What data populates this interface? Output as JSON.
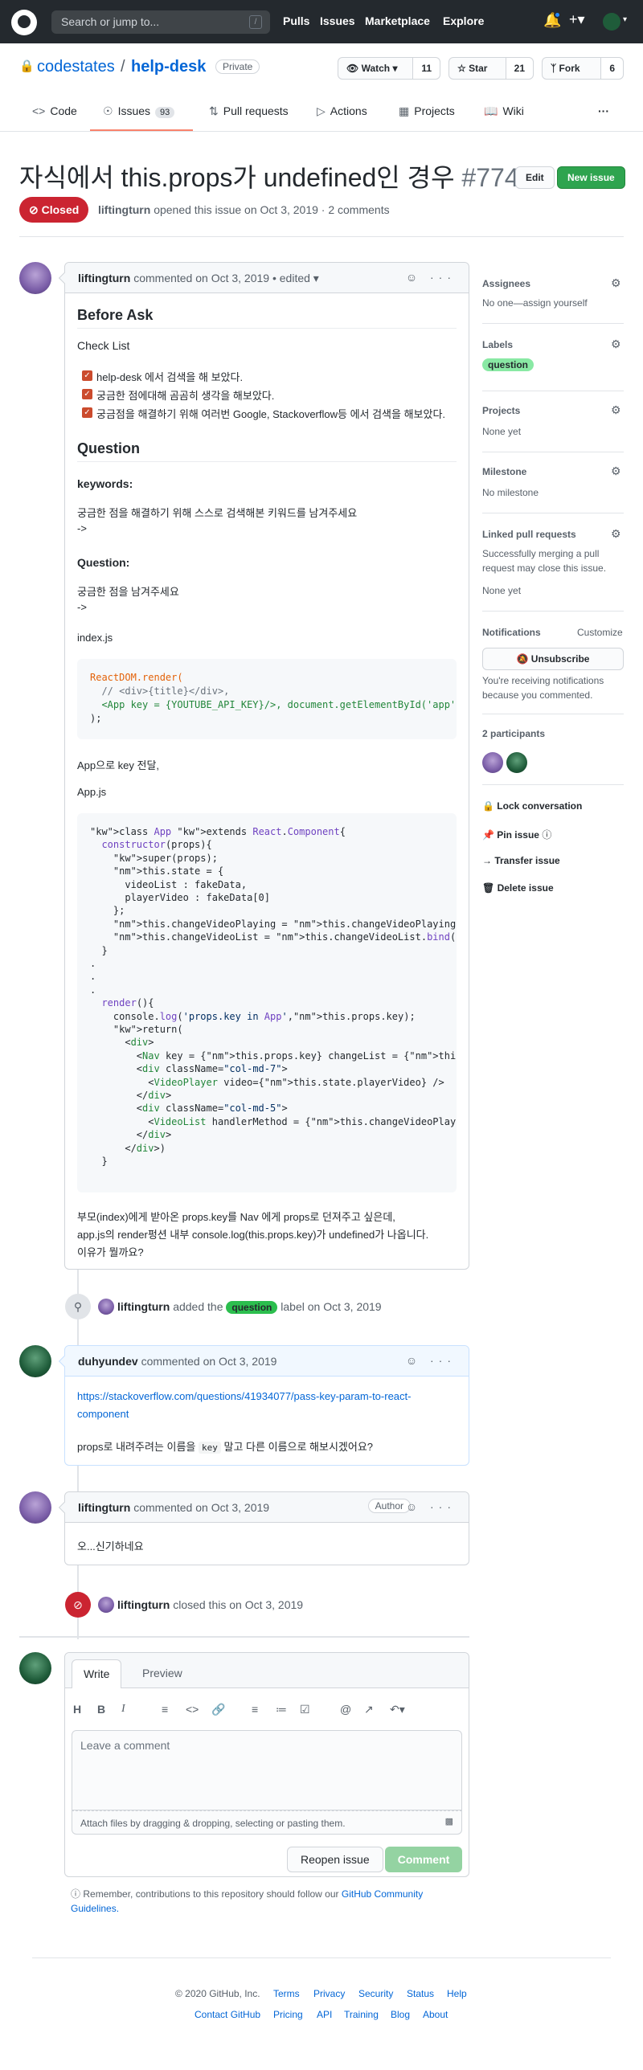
{
  "header": {
    "search_placeholder": "Search or jump to...",
    "search_key": "/",
    "nav": [
      "Pulls",
      "Issues",
      "Marketplace",
      "Explore"
    ]
  },
  "repo": {
    "owner": "codestates",
    "separator": "/",
    "name": "help-desk",
    "visibility": "Private",
    "watch_label": "Watch",
    "watch_count": "11",
    "star_label": "Star",
    "star_count": "21",
    "fork_label": "Fork",
    "fork_count": "6"
  },
  "tabs": [
    {
      "label": "Code"
    },
    {
      "label": "Issues",
      "count": "93"
    },
    {
      "label": "Pull requests"
    },
    {
      "label": "Actions"
    },
    {
      "label": "Projects"
    },
    {
      "label": "Wiki"
    }
  ],
  "issue": {
    "title": "자식에서 this.props가 undefined인 경우",
    "number": "#774",
    "edit_label": "Edit",
    "new_issue_label": "New issue",
    "state": "Closed",
    "author": "liftingturn",
    "meta": "opened this issue on Oct 3, 2019 · 2 comments"
  },
  "comment1": {
    "author": "liftingturn",
    "meta": "commented on Oct 3, 2019 • edited",
    "h_before": "Before Ask",
    "h_checklist": "Check List",
    "checks": [
      "help-desk 에서 검색을 해 보았다.",
      "궁금한 점에대해 곰곰히 생각을 해보았다.",
      "궁금점을 해결하기 위해 여러번 Google, Stackoverflow등 에서 검색을 해보았다."
    ],
    "h_question": "Question",
    "keywords_label": "keywords:",
    "keywords_text": "궁금한 점을 해결하기 위해 스스로 검색해본 키워드를 남겨주세요",
    "arrow1": "->",
    "question_label": "Question:",
    "question_text": "궁금한 점을 남겨주세요",
    "arrow2": "->",
    "file1": "index.js",
    "code1": [
      "ReactDOM.render(",
      "  // <div>{title}</div>,",
      "  <App key = {YOUTUBE_API_KEY}/>, document.getElementById('app')",
      ");"
    ],
    "app_pass": "App으로 key 전달,",
    "file2": "App.js",
    "code2": [
      "class App extends React.Component{",
      "  constructor(props){",
      "    super(props);",
      "    this.state = {",
      "      videoList : fakeData,",
      "      playerVideo : fakeData[0]",
      "    };",
      "    this.changeVideoPlaying = this.changeVideoPlaying.bind(this)",
      "    this.changeVideoList = this.changeVideoList.bind(this); // c",
      "  }",
      ".",
      ".",
      ".",
      "  render(){",
      "    console.log('props.key in App',this.props.key);",
      "    return(",
      "      <div>",
      "        <Nav key = {this.props.key} changeList = {this.changeVic",
      "        <div className=\"col-md-7\">",
      "          <VideoPlayer video={this.state.playerVideo} />",
      "        </div>",
      "        <div className=\"col-md-5\">",
      "          <VideoList handlerMethod = {this.changeVideoPlaying} v",
      "        </div>",
      "      </div>)",
      "  }"
    ],
    "closing": [
      "부모(index)에게 받아온 props.key를 Nav 에게 props로 던져주고 싶은데,",
      "app.js의 render펑션 내부 console.log(this.props.key)가 undefined가 나옵니다.",
      "이유가 뭘까요?"
    ]
  },
  "event_label": {
    "author": "liftingturn",
    "pre": "added the",
    "label": "question",
    "post": "label on Oct 3, 2019"
  },
  "comment2": {
    "author": "duhyundev",
    "meta": "commented on Oct 3, 2019",
    "link_line1": "https://stackoverflow.com/questions/41934077/pass-key-param-to-react-",
    "link_line2": "component",
    "text_pre": "props로 내려주려는 이름을",
    "text_code": "key",
    "text_post": "말고 다른 이름으로 해보시겠어요?"
  },
  "comment3": {
    "author": "liftingturn",
    "meta": "commented on Oct 3, 2019",
    "badge": "Author",
    "text": "오...신기하네요"
  },
  "event_closed": {
    "author": "liftingturn",
    "text": "closed this on Oct 3, 2019"
  },
  "sidebar": {
    "assignees_title": "Assignees",
    "assignees_value": "No one—assign yourself",
    "labels_title": "Labels",
    "label_value": "question",
    "projects_title": "Projects",
    "projects_value": "None yet",
    "milestone_title": "Milestone",
    "milestone_value": "No milestone",
    "linked_title": "Linked pull requests",
    "linked_line1": "Successfully merging a pull",
    "linked_line2": "request may close this issue.",
    "linked_value": "None yet",
    "notif_title": "Notifications",
    "customize": "Customize",
    "unsubscribe": "Unsubscribe",
    "notif_line1": "You're receiving notifications",
    "notif_line2": "because you commented.",
    "participants": "2 participants",
    "lock": "Lock conversation",
    "pin": "Pin issue",
    "transfer": "Transfer issue",
    "delete": "Delete issue"
  },
  "editor": {
    "tab_write": "Write",
    "tab_preview": "Preview",
    "placeholder": "Leave a comment",
    "attach": "Attach files by dragging & dropping, selecting or pasting them.",
    "reopen": "Reopen issue",
    "comment": "Comment",
    "remember_pre": "Remember, contributions to this repository should follow our",
    "remember_link_1": "GitHub Community",
    "remember_link_2": "Guidelines."
  },
  "footer": {
    "copyright": "© 2020 GitHub, Inc.",
    "row1": [
      "Terms",
      "Privacy",
      "Security",
      "Status",
      "Help"
    ],
    "row2": [
      "Contact GitHub",
      "Pricing",
      "API",
      "Training",
      "Blog",
      "About"
    ]
  },
  "colors": {
    "header_bg": "#24292e",
    "closed_red": "#cb2431",
    "new_issue_green": "#2ea44f",
    "link_blue": "#0366d6",
    "label_green": "#2cbe4e"
  }
}
